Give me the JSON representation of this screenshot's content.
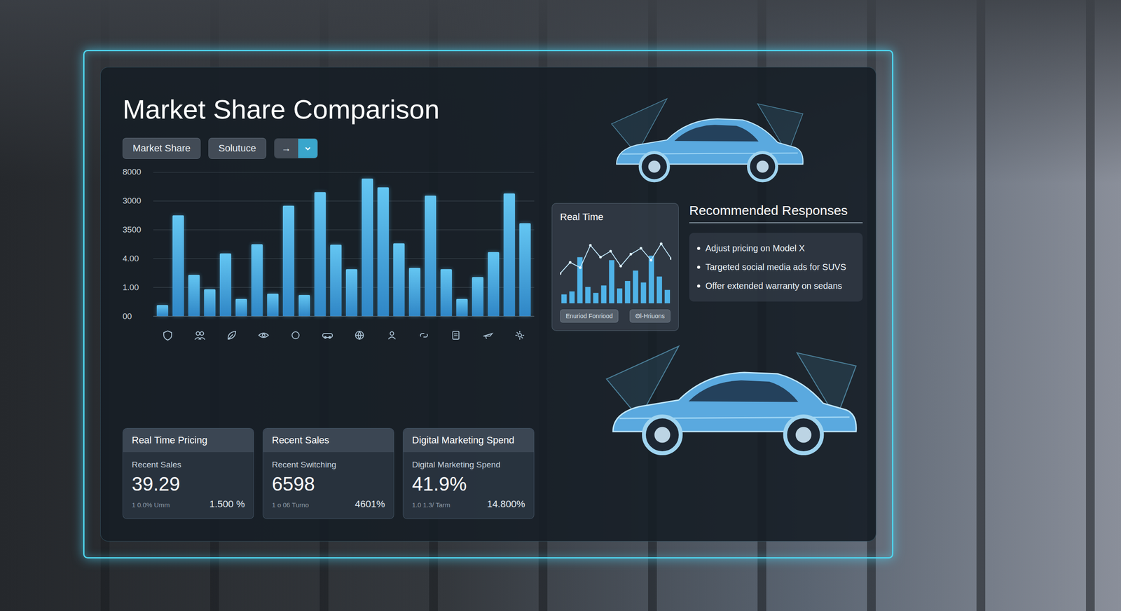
{
  "title": "Market Share Comparison",
  "toolbar": {
    "pills": [
      {
        "label": "Market Share"
      },
      {
        "label": "Solutuce"
      }
    ],
    "dropdown": {
      "label": "→"
    }
  },
  "chart": {
    "ticks": [
      "8000",
      "3000",
      "3500",
      "4.00",
      "1.00",
      "00"
    ],
    "series": [
      {
        "values": [
          15,
          140,
          57,
          37,
          87,
          24,
          100,
          31,
          153,
          29,
          172,
          99,
          65,
          191,
          179,
          101,
          67,
          167,
          65,
          24,
          54,
          89,
          170,
          129
        ]
      }
    ]
  },
  "realtime": {
    "title": "Real Time",
    "line": [
      40,
      55,
      48,
      78,
      62,
      70,
      50,
      66,
      74,
      58,
      80,
      60
    ],
    "bars": [
      12,
      16,
      62,
      22,
      14,
      24,
      58,
      20,
      30,
      44,
      28,
      64,
      36,
      18
    ],
    "buttons": [
      "Enuriod Fonriood",
      "Θl-Hriuons"
    ]
  },
  "recommendations": {
    "title": "Recommended Responses",
    "items": [
      "Adjust pricing on Model X",
      "Targeted social media ads for SUVS",
      "Offer extended warranty on sedans"
    ]
  },
  "cards": [
    {
      "title": "Real Time Pricing",
      "label": "Recent Sales",
      "value": "39.29",
      "sub": "1 0.0% Umm",
      "change": "1.500 %"
    },
    {
      "title": "Recent Sales",
      "label": "Recent Switching",
      "value": "6598",
      "sub": "1 o 06 Turno",
      "change": "4601%"
    },
    {
      "title": "Digital Marketing Spend",
      "label": "Digital Marketing Spend",
      "value": "41.9%",
      "sub": "1.0 1.3/ Tarm",
      "change": "14.800%"
    }
  ]
}
